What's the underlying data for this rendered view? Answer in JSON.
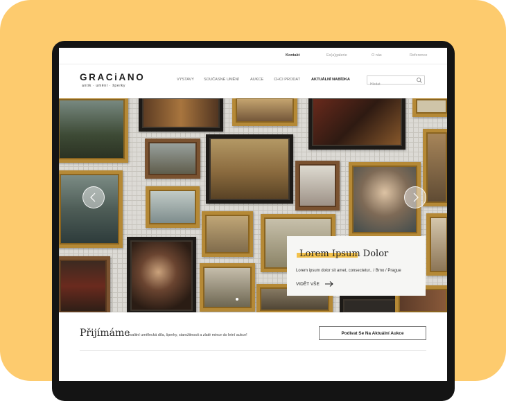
{
  "colors": {
    "background_accent": "#fdcb6e",
    "device_frame": "#141414",
    "highlight": "#f2c14b"
  },
  "utility_nav": [
    "Kontakt",
    "Ex(a)galerie",
    "O nás",
    "Reference"
  ],
  "brand": {
    "name": "GRACiANO",
    "tagline": "antik · umění · šperky"
  },
  "main_nav": {
    "items": [
      "VÝSTAVY",
      "SOUČASNÉ UMĚNÍ",
      "AUKCE",
      "CHCI PRODAT",
      "AKTUÁLNÍ NABÍDKA"
    ],
    "active": "AKTUÁLNÍ NABÍDKA"
  },
  "search": {
    "placeholder": "Hledat",
    "icon": "search-icon"
  },
  "hero": {
    "title": "Lorem Ipsum Dolor",
    "subtitle": "Lorem ipsum dolor sit amet, consectetur.. / Brno / Prague",
    "link_label": "VIDĚT VŠE",
    "link_icon": "arrow-right-icon",
    "prev_icon": "chevron-left-icon",
    "next_icon": "chevron-right-icon",
    "slide_count": 1,
    "active_slide": 1
  },
  "intro": {
    "heading": "Přijímáme",
    "text": "kvalitní umělecká díla, šperky, starožitnosti a zlaté mince do letní aukce!",
    "button_label": "Podívat Se Na Aktuální Aukce"
  }
}
